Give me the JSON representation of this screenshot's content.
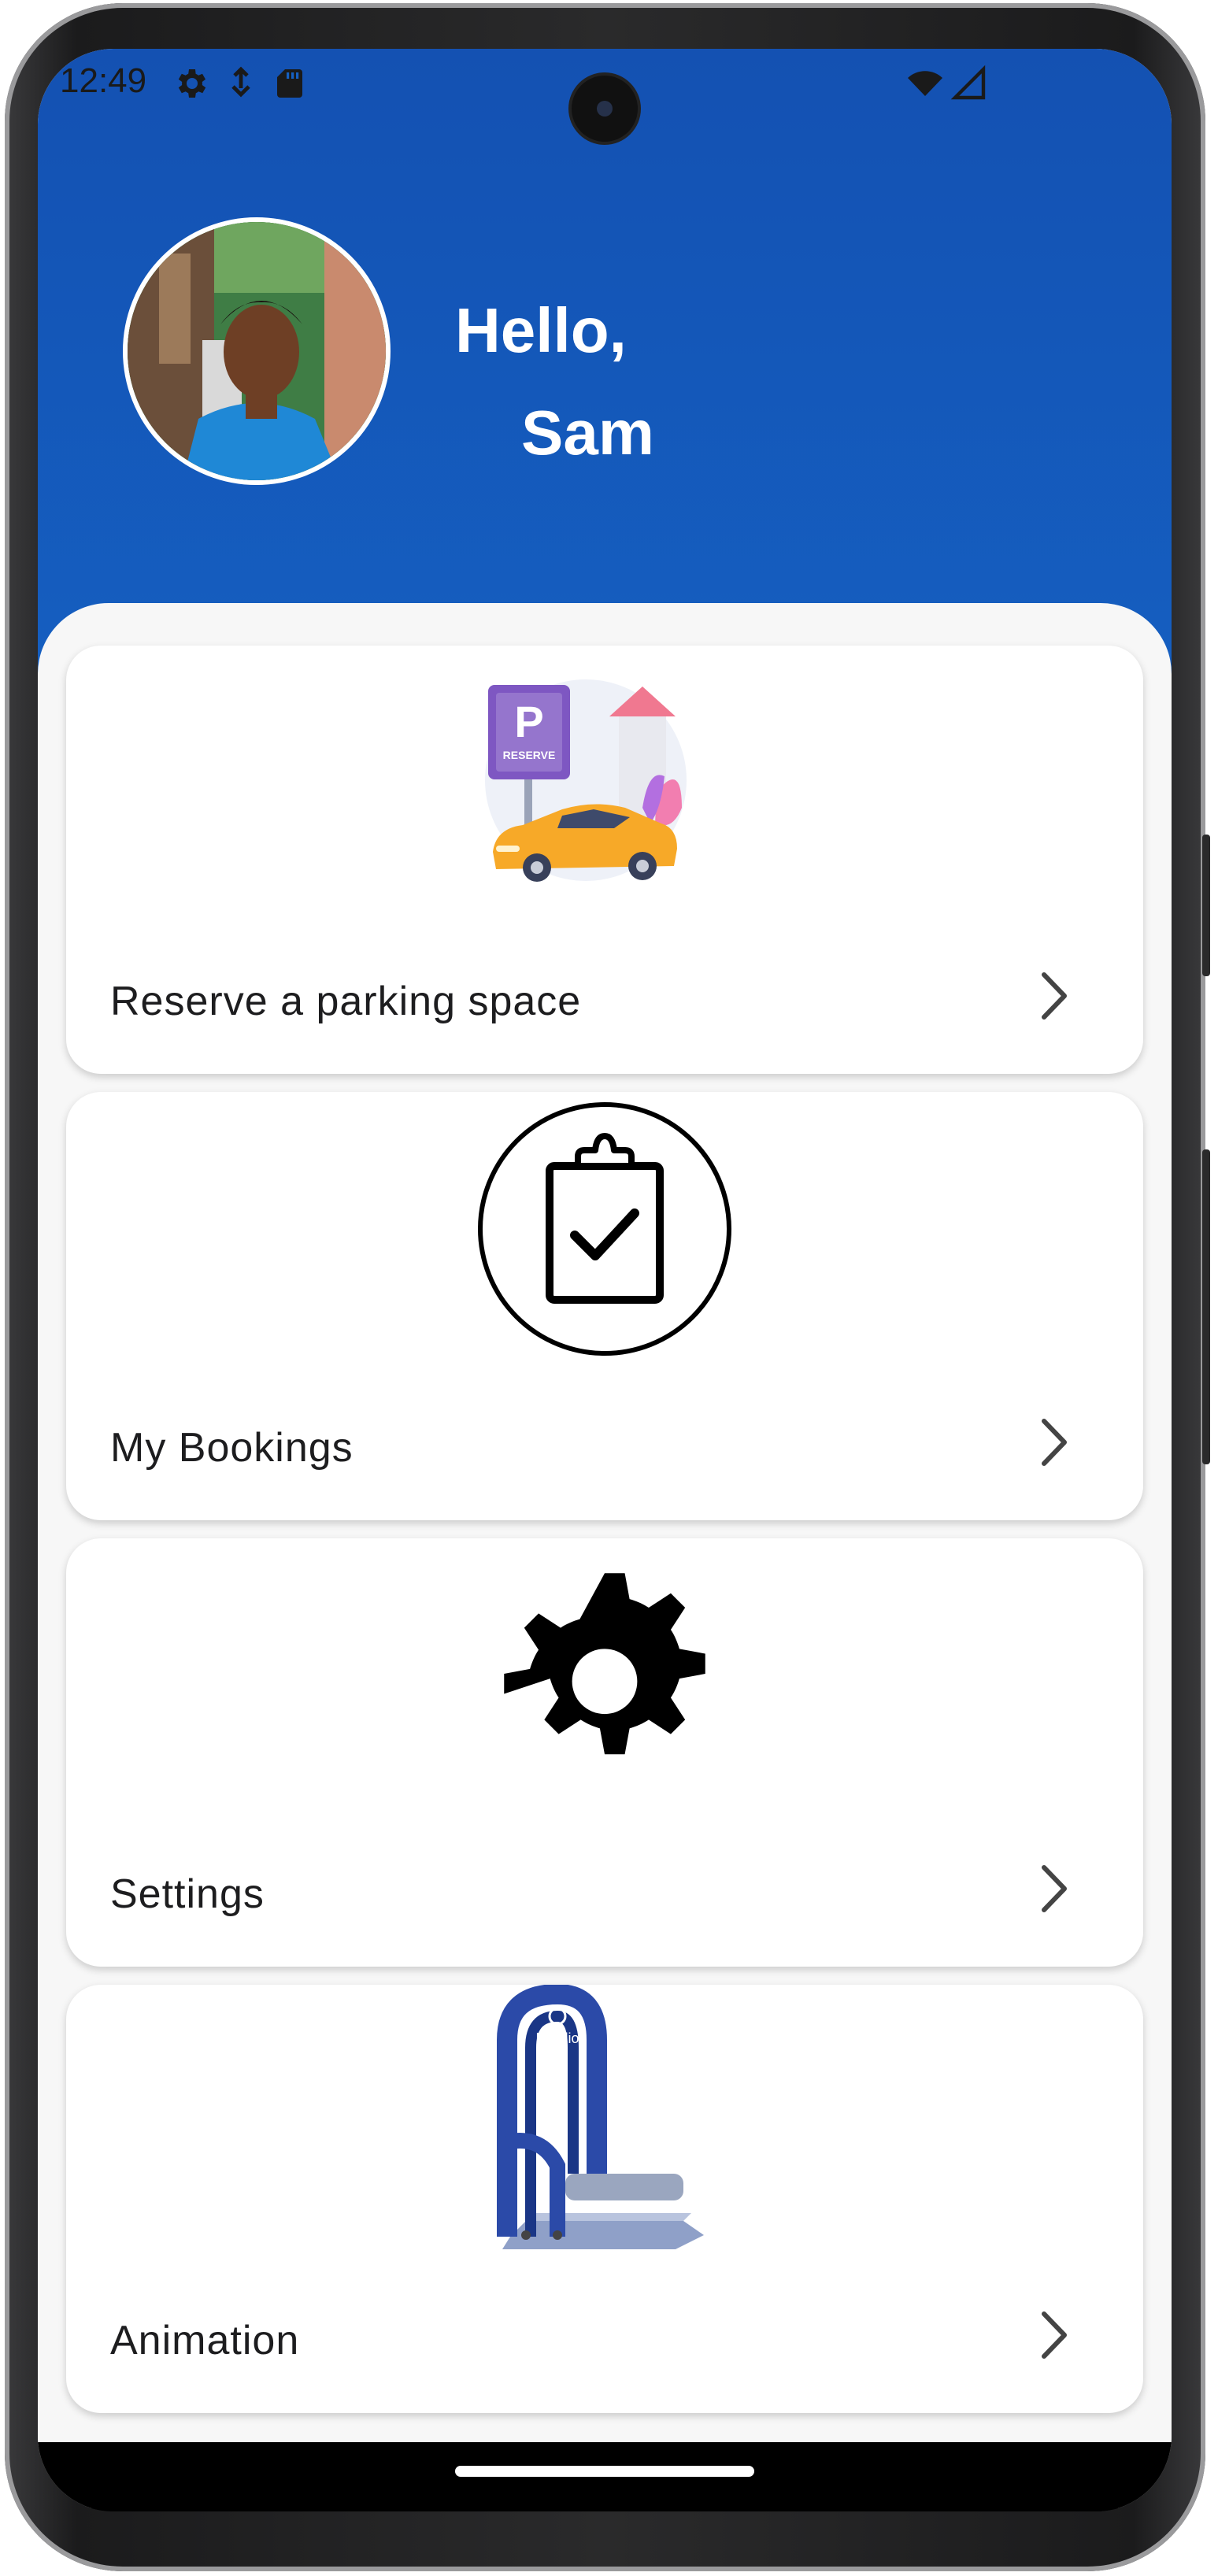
{
  "status_bar": {
    "time": "12:49",
    "icons": [
      "gear-icon",
      "usb-debug-icon",
      "sd-card-icon",
      "wifi-icon",
      "signal-icon"
    ]
  },
  "header": {
    "greeting_line1": "Hello,",
    "greeting_line2": "Sam",
    "avatar": "profile-photo",
    "background_color": "#1560c2"
  },
  "menu": {
    "items": [
      {
        "label": "Reserve a parking space",
        "icon": "parking-reserve-illustration"
      },
      {
        "label": "My Bookings",
        "icon": "clipboard-check-icon"
      },
      {
        "label": "Settings",
        "icon": "gear-icon"
      },
      {
        "label": "Animation",
        "icon": "parking-barrier-illustration"
      }
    ]
  }
}
